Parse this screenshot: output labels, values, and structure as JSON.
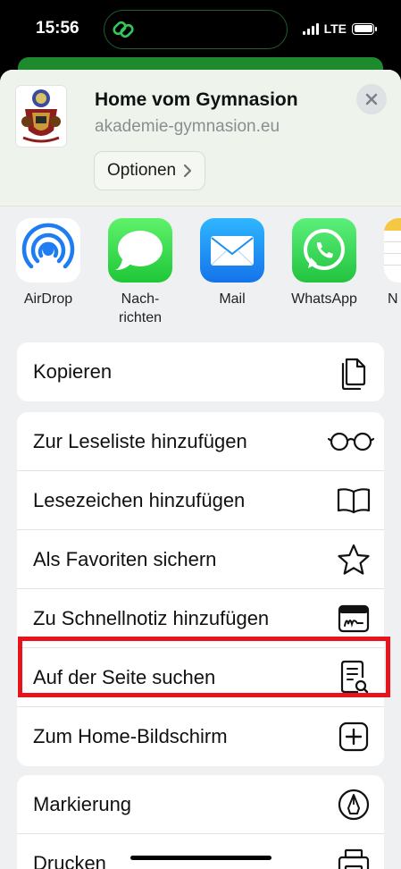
{
  "status_bar": {
    "time": "15:56",
    "network": "LTE"
  },
  "header": {
    "title": "Home vom Gymnasion",
    "url": "akademie-gymnasion.eu",
    "options_label": "Optionen"
  },
  "share_targets": [
    {
      "label": "AirDrop",
      "icon": "airdrop-icon"
    },
    {
      "label": "Nach-\nrichten",
      "icon": "messages-icon"
    },
    {
      "label": "Mail",
      "icon": "mail-icon"
    },
    {
      "label": "WhatsApp",
      "icon": "whatsapp-icon"
    },
    {
      "label": "N",
      "icon": "notes-icon"
    }
  ],
  "group1": [
    {
      "label": "Kopieren",
      "icon": "copy-icon"
    }
  ],
  "group2": [
    {
      "label": "Zur Leseliste hinzufügen",
      "icon": "glasses-icon"
    },
    {
      "label": "Lesezeichen hinzufügen",
      "icon": "book-icon"
    },
    {
      "label": "Als Favoriten sichern",
      "icon": "star-icon"
    },
    {
      "label": "Zu Schnellnotiz hinzufügen",
      "icon": "quick-note-icon"
    },
    {
      "label": "Auf der Seite suchen",
      "icon": "find-on-page-icon"
    },
    {
      "label": "Zum Home-Bildschirm",
      "icon": "add-square-icon"
    }
  ],
  "group3": [
    {
      "label": "Markierung",
      "icon": "markup-icon"
    },
    {
      "label": "Drucken",
      "icon": "print-icon"
    }
  ],
  "colors": {
    "highlight": "#e8141b",
    "accent_green": "#1d8a2e"
  }
}
